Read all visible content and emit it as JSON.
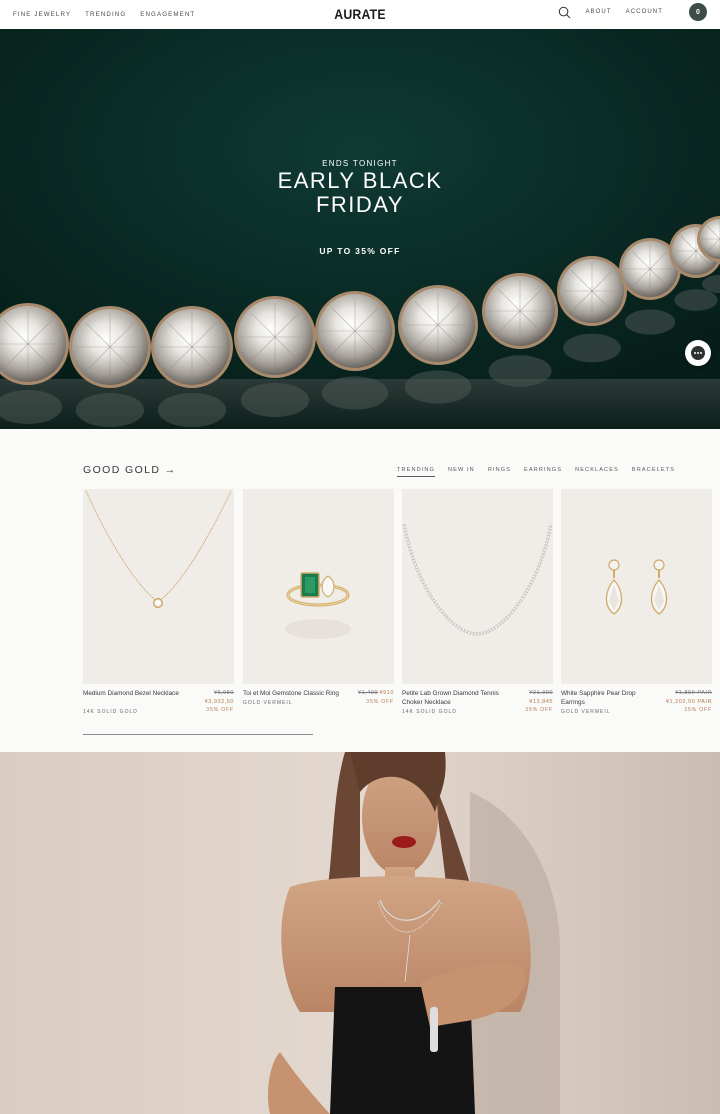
{
  "nav": {
    "left_links": [
      "FINE JEWELRY",
      "TRENDING",
      "ENGAGEMENT"
    ],
    "logo": "AURATE",
    "about": "ABOUT",
    "account": "ACCOUNT",
    "cart_count": "0"
  },
  "hero": {
    "eyebrow": "ENDS TONIGHT",
    "title_line1": "EARLY BLACK",
    "title_line2": "FRIDAY",
    "offer": "UP TO 35% OFF"
  },
  "products": {
    "title": "GOOD GOLD →",
    "tabs": [
      "TRENDING",
      "NEW IN",
      "RINGS",
      "EARRINGS",
      "NECKLACES",
      "BRACELETS"
    ],
    "active_tab": "TRENDING",
    "items": [
      {
        "name": "Medium Diamond Bezel Necklace",
        "sub": "14K SOLID GOLD",
        "old_price": "¥6,050",
        "new_price": "¥3,932,50",
        "discount": "35% OFF"
      },
      {
        "name": "Toi et Moi Gemstone Classic Ring",
        "sub": "GOLD VERMEIL",
        "old_price": "¥1,400",
        "new_price": "¥910",
        "discount": "35% OFF"
      },
      {
        "name": "Petite Lab Grown Diamond Tennis Choker Necklace",
        "sub": "14K SOLID GOLD",
        "old_price": "¥21,300",
        "new_price": "¥13,845",
        "discount": "35% OFF"
      },
      {
        "name": "White Sapphire Pear Drop Earrings",
        "sub": "GOLD VERMEIL",
        "old_price": "¥1,850 PAIR",
        "new_price": "¥1,202,50 PAIR",
        "discount": "35% OFF"
      }
    ]
  },
  "colors": {
    "hero_bg": "#0a2b25",
    "accent_price": "#b47a4e",
    "cart_bg": "#3e4c4a",
    "card_bg": "#f0ece8"
  },
  "icons": {
    "search": "search-icon",
    "chat": "chat-icon"
  }
}
